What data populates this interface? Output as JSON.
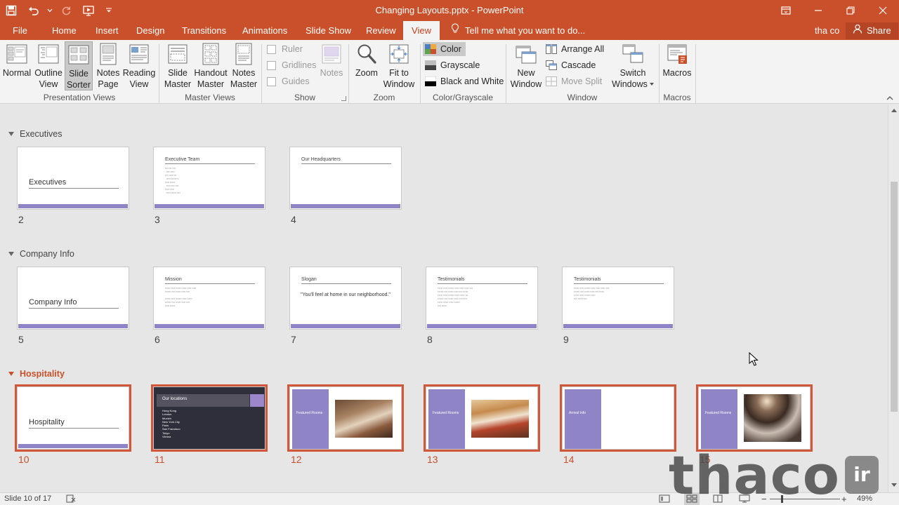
{
  "window": {
    "title": "Changing Layouts.pptx - PowerPoint"
  },
  "qat": {
    "icons": [
      "save-icon",
      "undo-icon",
      "redo-icon",
      "start-from-beginning-icon",
      "customize-qat-icon"
    ]
  },
  "tabs": [
    {
      "label": "File"
    },
    {
      "label": "Home"
    },
    {
      "label": "Insert"
    },
    {
      "label": "Design"
    },
    {
      "label": "Transitions"
    },
    {
      "label": "Animations"
    },
    {
      "label": "Slide Show"
    },
    {
      "label": "Review"
    },
    {
      "label": "View"
    }
  ],
  "tell_me": "Tell me what you want to do...",
  "user": "tha co",
  "share": "Share",
  "ribbon": {
    "presentation_views": {
      "label": "Presentation Views",
      "buttons": [
        {
          "line1": "Normal",
          "line2": ""
        },
        {
          "line1": "Outline",
          "line2": "View"
        },
        {
          "line1": "Slide",
          "line2": "Sorter"
        },
        {
          "line1": "Notes",
          "line2": "Page"
        },
        {
          "line1": "Reading",
          "line2": "View"
        }
      ]
    },
    "master_views": {
      "label": "Master Views",
      "buttons": [
        {
          "line1": "Slide",
          "line2": "Master"
        },
        {
          "line1": "Handout",
          "line2": "Master"
        },
        {
          "line1": "Notes",
          "line2": "Master"
        }
      ]
    },
    "show": {
      "label": "Show",
      "items": [
        "Ruler",
        "Gridlines",
        "Guides"
      ],
      "notes": "Notes"
    },
    "zoom": {
      "label": "Zoom",
      "zoom": "Zoom",
      "fit_line1": "Fit to",
      "fit_line2": "Window"
    },
    "color": {
      "label": "Color/Grayscale",
      "items": [
        "Color",
        "Grayscale",
        "Black and White"
      ]
    },
    "window": {
      "label": "Window",
      "new_line1": "New",
      "new_line2": "Window",
      "arrange_all": "Arrange All",
      "cascade": "Cascade",
      "move_split": "Move Split",
      "switch_line1": "Switch",
      "switch_line2": "Windows"
    },
    "macros": {
      "label": "Macros",
      "button": "Macros"
    }
  },
  "sections": [
    {
      "name": "Executives"
    },
    {
      "name": "Company Info"
    },
    {
      "name": "Hospitality"
    }
  ],
  "slides": {
    "s2": {
      "num": "2",
      "title": "Executives"
    },
    "s3": {
      "num": "3",
      "title": "Executive Team"
    },
    "s4": {
      "num": "4",
      "title": "Our Headquarters"
    },
    "s5": {
      "num": "5",
      "title": "Company Info"
    },
    "s6": {
      "num": "6",
      "title": "Mission"
    },
    "s7": {
      "num": "7",
      "title": "Slogan",
      "quote": "\"You'll feel at home in our neighborhood.\""
    },
    "s8": {
      "num": "8",
      "title": "Testimonials"
    },
    "s9": {
      "num": "9",
      "title": "Testimonials"
    },
    "s10": {
      "num": "10",
      "title": "Hospitality"
    },
    "s11": {
      "num": "11",
      "title": "Our locations",
      "items": [
        "Hong Kong",
        "London",
        "Munich",
        "New York City",
        "Paris",
        "San Francisco",
        "Tokyo",
        "Vienna"
      ]
    },
    "s12": {
      "num": "12",
      "title": "Featured Rooms"
    },
    "s13": {
      "num": "13",
      "title": "Featured Rooms"
    },
    "s14": {
      "num": "14",
      "title": "Arrival Info"
    },
    "s15": {
      "num": "15",
      "title": "Featured Rooms"
    }
  },
  "status": {
    "slide_count": "Slide 10 of 17",
    "zoom": "49%"
  },
  "watermark": {
    "text": "thaco",
    "suffix": "ir"
  },
  "colors": {
    "accent": "#c9502a",
    "slide_footer": "#8f85c6"
  }
}
